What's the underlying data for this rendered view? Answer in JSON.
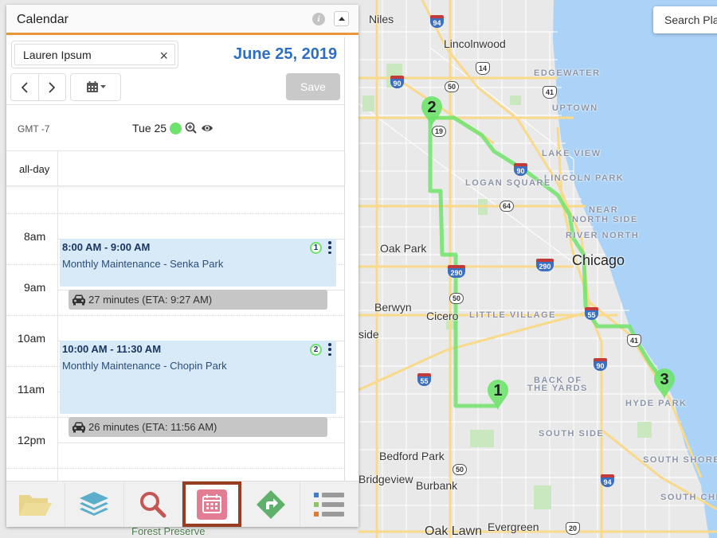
{
  "map": {
    "search_placeholder": "Search Pla",
    "labels": {
      "niles": "Niles",
      "lincolnwood": "Lincolnwood",
      "edgewater": "EDGEWATER",
      "uptown": "UPTOWN",
      "lake_view": "LAKE VIEW",
      "lincoln_park": "LINCOLN PARK",
      "logan_square": "LOGAN SQUARE",
      "near": "NEAR",
      "north_side": "NORTH SIDE",
      "river_north": "RIVER NORTH",
      "chicago": "Chicago",
      "oak_park": "Oak Park",
      "berwyn": "Berwyn",
      "cicero": "Cicero",
      "little_village": "LITTLE VILLAGE",
      "riverside": "side",
      "back_of": "BACK OF",
      "the_yards": "THE YARDS",
      "hyde_park": "HYDE PARK",
      "south_side": "SOUTH SIDE",
      "south_shore": "SOUTH SHORE",
      "south_chicago": "SOUTH CHIC",
      "bedford_park": "Bedford Park",
      "bridgeview": "Bridgeview",
      "burbank": "Burbank",
      "oak_lawn": "Oak Lawn",
      "evergreen": "Evergreen",
      "park": "Park",
      "forest_preserve": "Forest Preserve"
    },
    "shields": {
      "i94_north": "94",
      "i90_north": "90",
      "us14": "14",
      "il50_north": "50",
      "us41_north": "41",
      "il19": "19",
      "i90_mid": "90",
      "il64": "64",
      "i290_west": "290",
      "i290_east": "290",
      "il50_mid": "50",
      "i55_west": "55",
      "i55_east": "55",
      "us41_south": "41",
      "i90_south": "90",
      "il50_south": "50",
      "i94_south": "94",
      "us20": "20"
    },
    "pins": [
      "1",
      "2",
      "3"
    ],
    "route_color": "#6ee36b"
  },
  "panel": {
    "title": "Calendar",
    "user_value": "Lauren Ipsum",
    "date_title": "June 25, 2019",
    "save_label": "Save",
    "timezone": "GMT -7",
    "day_label": "Tue 25",
    "allday_label": "all-day",
    "hours": [
      "8am",
      "9am",
      "10am",
      "11am",
      "12pm"
    ],
    "events": [
      {
        "time": "8:00 AM - 9:00 AM",
        "title": "Monthly Maintenance - Senka Park",
        "badge": "1"
      },
      {
        "time": "10:00 AM - 11:30 AM",
        "title": "Monthly Maintenance - Chopin Park",
        "badge": "2"
      }
    ],
    "travel": [
      {
        "text": "27 minutes (ETA: 9:27 AM)"
      },
      {
        "text": "26 minutes (ETA: 11:56 AM)"
      }
    ],
    "toolbar": [
      "folder-icon",
      "layers-icon",
      "search-icon",
      "calendar-icon",
      "directions-icon",
      "legend-list-icon"
    ],
    "active_tool": "calendar-icon",
    "accent_color": "#e8963a",
    "date_color": "#2e6fc4"
  }
}
